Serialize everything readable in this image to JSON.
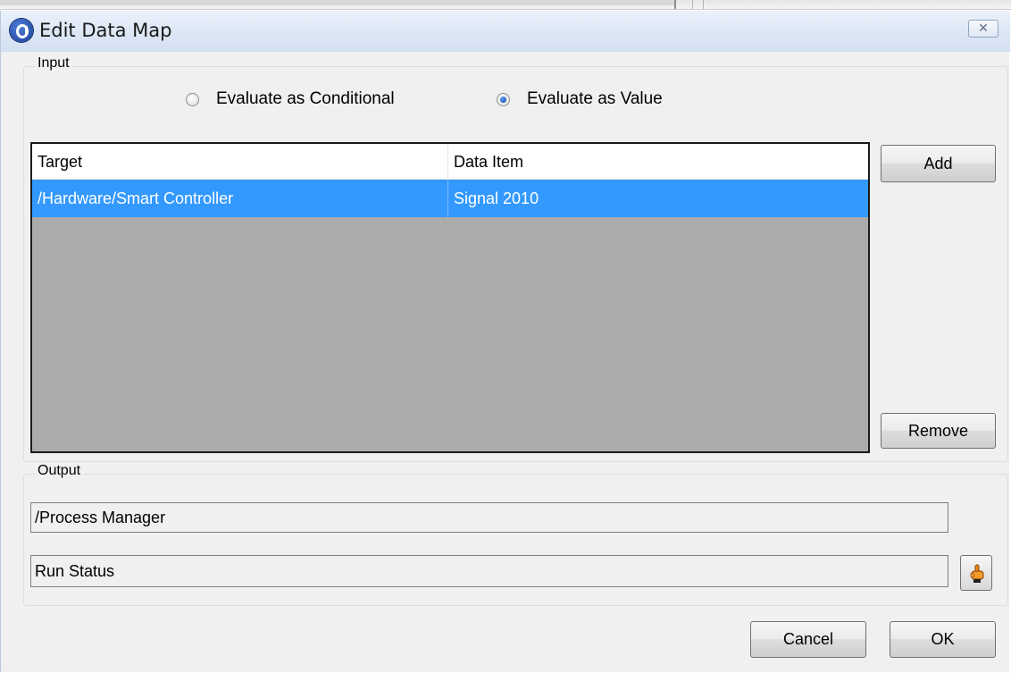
{
  "window": {
    "title": "Edit Data Map",
    "close_label": "✕"
  },
  "input": {
    "label": "Input",
    "radio_conditional": "Evaluate as Conditional",
    "radio_value": "Evaluate as Value",
    "selected": "value",
    "columns": [
      "Target",
      "Data Item"
    ],
    "rows": [
      {
        "target": "/Hardware/Smart Controller",
        "data_item": "Signal 2010"
      }
    ],
    "add_label": "Add",
    "remove_label": "Remove"
  },
  "output": {
    "label": "Output",
    "path": "/Process Manager",
    "item": "Run Status"
  },
  "buttons": {
    "cancel": "Cancel",
    "ok": "OK"
  },
  "colors": {
    "selection": "#3399ff",
    "list_bg": "#ababab",
    "dialog_bg": "#f0f0f0"
  },
  "icons": {
    "app": "app-logo-icon",
    "picker": "pointing-hand-icon"
  }
}
